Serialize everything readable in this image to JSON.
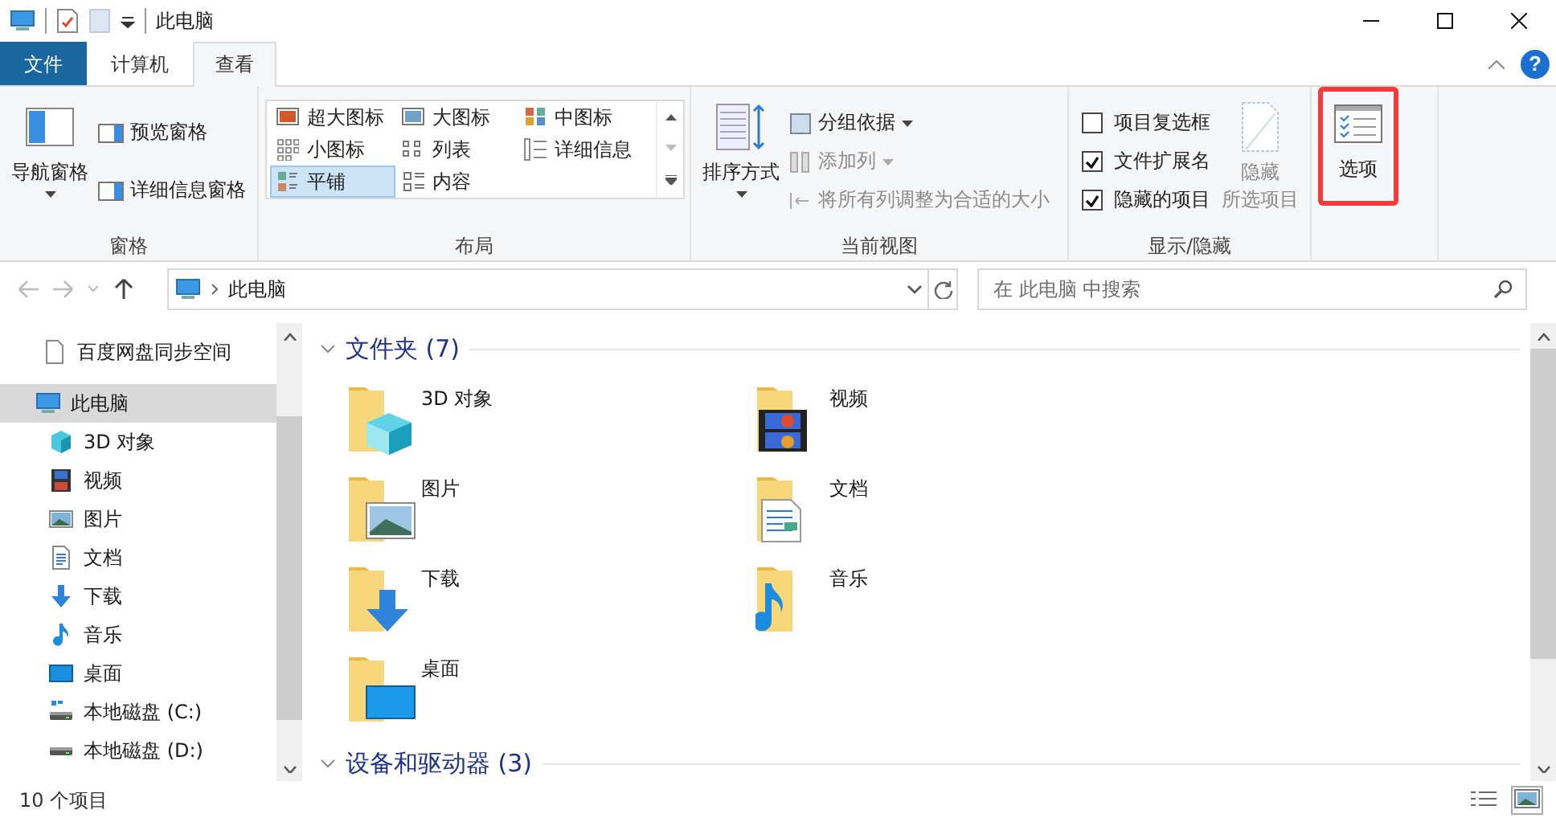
{
  "title_bar": {
    "title": "此电脑"
  },
  "ribbon_tabs": [
    {
      "label": "文件",
      "kind": "file",
      "selected": false
    },
    {
      "label": "计算机",
      "kind": "tab",
      "selected": false
    },
    {
      "label": "查看",
      "kind": "tab",
      "selected": true
    }
  ],
  "help": "?",
  "ribbon": {
    "panes": {
      "label": "窗格",
      "large": "导航窗格",
      "small": [
        "预览窗格",
        "详细信息窗格"
      ]
    },
    "layout": {
      "label": "布局",
      "options": [
        {
          "label": "超大图标",
          "kind": "xl",
          "selected": false
        },
        {
          "label": "大图标",
          "kind": "large",
          "selected": false
        },
        {
          "label": "中图标",
          "kind": "medium",
          "selected": false
        },
        {
          "label": "小图标",
          "kind": "small",
          "selected": false
        },
        {
          "label": "列表",
          "kind": "list",
          "selected": false
        },
        {
          "label": "详细信息",
          "kind": "details",
          "selected": false
        },
        {
          "label": "平铺",
          "kind": "tiles",
          "selected": true
        },
        {
          "label": "内容",
          "kind": "content",
          "selected": false
        }
      ]
    },
    "current_view": {
      "label": "当前视图",
      "sort": "排序方式",
      "items": [
        {
          "label": "分组依据",
          "kind": "group",
          "dropdown": true,
          "disabled": false
        },
        {
          "label": "添加列",
          "kind": "columns",
          "dropdown": true,
          "disabled": true
        },
        {
          "label": "将所有列调整为合适的大小",
          "kind": "fit",
          "dropdown": false,
          "disabled": true
        }
      ]
    },
    "show_hide": {
      "label": "显示/隐藏",
      "checkboxes": [
        {
          "label": "项目复选框",
          "checked": false
        },
        {
          "label": "文件扩展名",
          "checked": true
        },
        {
          "label": "隐藏的项目",
          "checked": true
        }
      ],
      "hide_button": {
        "lines": [
          "隐藏",
          "所选项目"
        ],
        "disabled": true
      }
    },
    "options": {
      "label": "选项",
      "highlighted": true
    }
  },
  "address": {
    "path": "此电脑"
  },
  "search": {
    "placeholder": "在 此电脑 中搜索"
  },
  "nav_tree": [
    {
      "label": "百度网盘同步空间",
      "kind": "file",
      "selected": false
    },
    {
      "label": "此电脑",
      "kind": "pc",
      "selected": true,
      "children": [
        {
          "label": "3D 对象",
          "kind": "object",
          "selected": false
        },
        {
          "label": "视频",
          "kind": "video",
          "selected": false
        },
        {
          "label": "图片",
          "kind": "pictures",
          "selected": false
        },
        {
          "label": "文档",
          "kind": "documents",
          "selected": false
        },
        {
          "label": "下载",
          "kind": "downloads",
          "selected": false
        },
        {
          "label": "音乐",
          "kind": "music",
          "selected": false
        },
        {
          "label": "桌面",
          "kind": "desktop",
          "selected": false
        },
        {
          "label": "本地磁盘 (C:)",
          "kind": "system",
          "selected": false
        },
        {
          "label": "本地磁盘 (D:)",
          "kind": "drive",
          "selected": false
        }
      ]
    }
  ],
  "sections": [
    {
      "title": "文件夹 (7)",
      "items": [
        {
          "label": "3D 对象",
          "kind": "object"
        },
        {
          "label": "视频",
          "kind": "video"
        },
        {
          "label": "图片",
          "kind": "pictures"
        },
        {
          "label": "文档",
          "kind": "documents"
        },
        {
          "label": "下载",
          "kind": "downloads"
        },
        {
          "label": "音乐",
          "kind": "music"
        },
        {
          "label": "桌面",
          "kind": "desktop"
        }
      ]
    },
    {
      "title": "设备和驱动器 (3)"
    }
  ],
  "status_bar": {
    "count": "10 个项目"
  }
}
